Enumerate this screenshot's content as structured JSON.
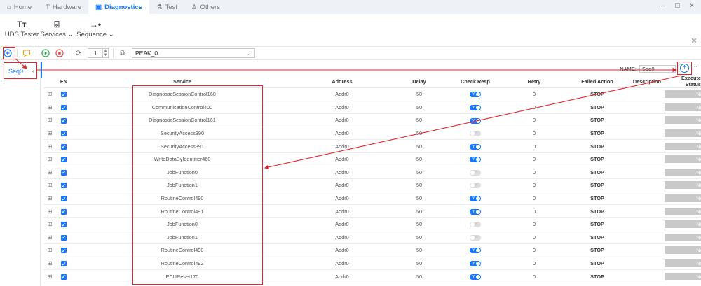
{
  "nav": {
    "tabs": [
      {
        "label": "Home",
        "icon": "home-icon"
      },
      {
        "label": "Hardware",
        "icon": "hardware-icon"
      },
      {
        "label": "Diagnostics",
        "icon": "diagnostics-icon",
        "active": true
      },
      {
        "label": "Test",
        "icon": "test-icon"
      },
      {
        "label": "Others",
        "icon": "others-icon"
      }
    ],
    "window_controls": "– □ ×"
  },
  "ribbon": {
    "uds_tester": "UDS Tester",
    "services": "Services ⌄",
    "sequence": "Sequence ⌄"
  },
  "toolbar": {
    "cycle_count": "1",
    "device": "PEAK_0"
  },
  "sequence_tab": {
    "label": "Seq0",
    "close": "×"
  },
  "name_field": {
    "label": "NAME:",
    "value": "Seq0"
  },
  "table": {
    "headers": {
      "en": "EN",
      "service": "Service",
      "address": "Address",
      "delay": "Delay",
      "check_resp": "Check Resp",
      "retry": "Retry",
      "failed_action": "Failed Action",
      "description": "Description",
      "execute_status": "Execute Status"
    },
    "rows": [
      {
        "service": "DiagnosticSessionControl160",
        "address": "Addr0",
        "delay": "50",
        "check": true,
        "retry": "0",
        "action": "STOP",
        "description": "",
        "status": "Not Start"
      },
      {
        "service": "CommunicationControl400",
        "address": "Addr0",
        "delay": "50",
        "check": true,
        "retry": "0",
        "action": "STOP",
        "description": "",
        "status": "Not Start"
      },
      {
        "service": "DiagnosticSessionControl161",
        "address": "Addr0",
        "delay": "50",
        "check": true,
        "retry": "0",
        "action": "STOP",
        "description": "",
        "status": "Not Start"
      },
      {
        "service": "SecurityAccess390",
        "address": "Addr0",
        "delay": "50",
        "check": false,
        "retry": "0",
        "action": "STOP",
        "description": "",
        "status": "Not Start"
      },
      {
        "service": "SecurityAccess391",
        "address": "Addr0",
        "delay": "50",
        "check": true,
        "retry": "0",
        "action": "STOP",
        "description": "",
        "status": "Not Start"
      },
      {
        "service": "WriteDataByIdentifier460",
        "address": "Addr0",
        "delay": "50",
        "check": true,
        "retry": "0",
        "action": "STOP",
        "description": "",
        "status": "Not Start"
      },
      {
        "service": "JobFunction0",
        "address": "Addr0",
        "delay": "50",
        "check": false,
        "retry": "0",
        "action": "STOP",
        "description": "",
        "status": "Not Start"
      },
      {
        "service": "JobFunction1",
        "address": "Addr0",
        "delay": "50",
        "check": false,
        "retry": "0",
        "action": "STOP",
        "description": "",
        "status": "Not Start"
      },
      {
        "service": "RoutineControl490",
        "address": "Addr0",
        "delay": "50",
        "check": true,
        "retry": "0",
        "action": "STOP",
        "description": "",
        "status": "Not Start"
      },
      {
        "service": "RoutineControl491",
        "address": "Addr0",
        "delay": "50",
        "check": true,
        "retry": "0",
        "action": "STOP",
        "description": "",
        "status": "Not Start"
      },
      {
        "service": "JobFunction0",
        "address": "Addr0",
        "delay": "50",
        "check": false,
        "retry": "0",
        "action": "STOP",
        "description": "",
        "status": "Not Start"
      },
      {
        "service": "JobFunction1",
        "address": "Addr0",
        "delay": "50",
        "check": false,
        "retry": "0",
        "action": "STOP",
        "description": "",
        "status": "Not Start"
      },
      {
        "service": "RoutineControl490",
        "address": "Addr0",
        "delay": "50",
        "check": true,
        "retry": "0",
        "action": "STOP",
        "description": "",
        "status": "Not Start"
      },
      {
        "service": "RoutineControl492",
        "address": "Addr0",
        "delay": "50",
        "check": true,
        "retry": "0",
        "action": "STOP",
        "description": "",
        "status": "Not Start"
      },
      {
        "service": "ECUReset170",
        "address": "Addr0",
        "delay": "50",
        "check": true,
        "retry": "0",
        "action": "STOP",
        "description": "",
        "status": "Not Start"
      }
    ]
  },
  "toggle_labels": {
    "on": "Y",
    "off": "N"
  },
  "annotation_color": "#e0262d",
  "accent_color": "#1677ff"
}
